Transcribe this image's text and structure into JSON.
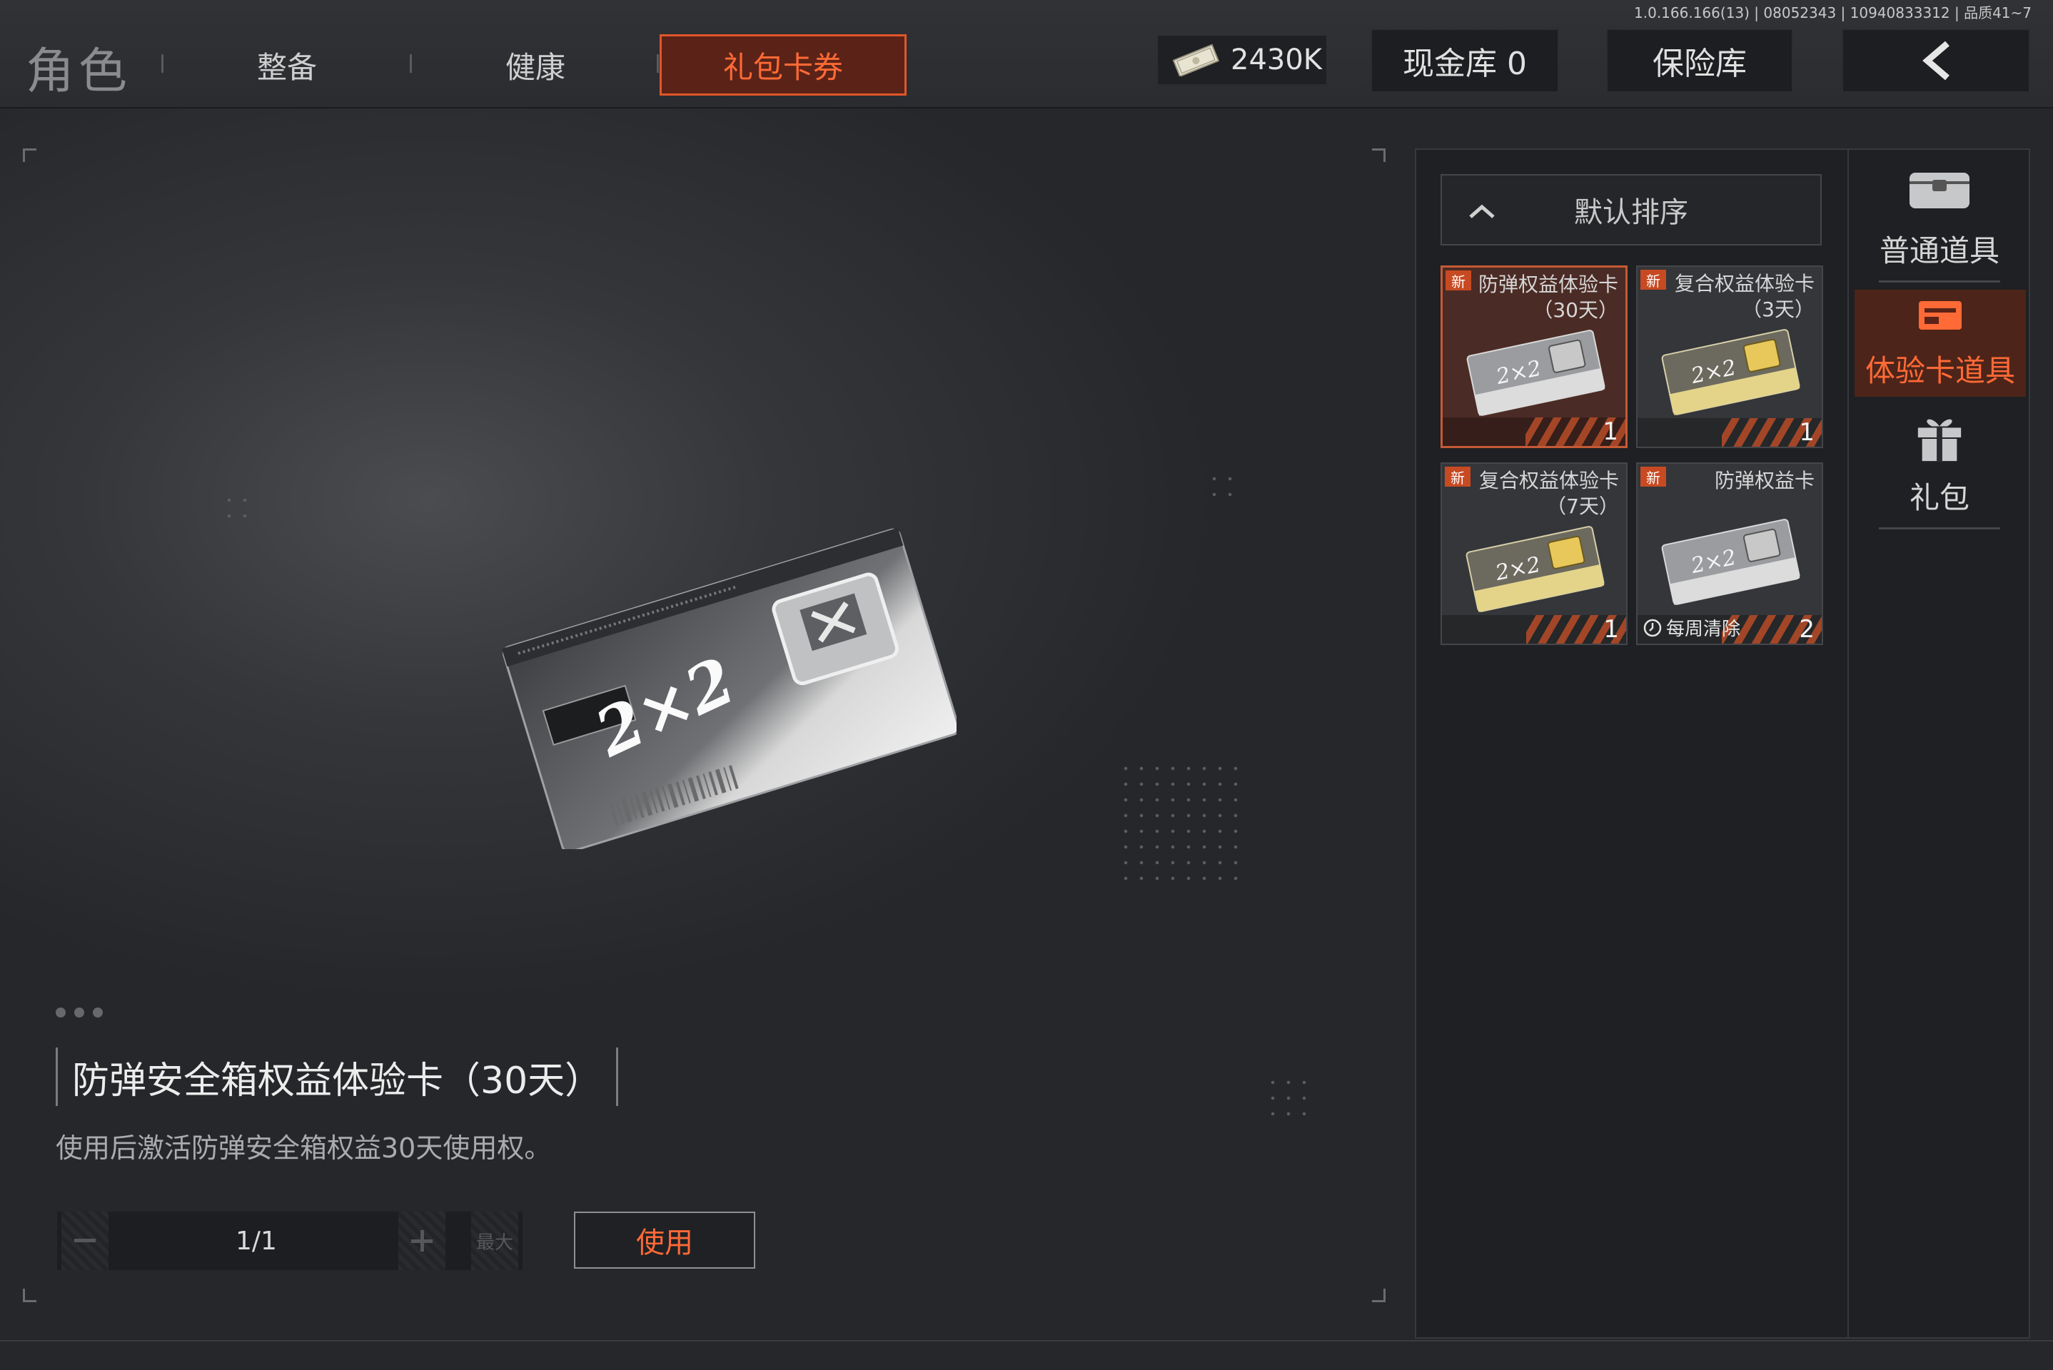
{
  "version": "1.0.166.166(13) | 08052343 | 10940833312 | 品质41~7",
  "nav": {
    "title": "角色",
    "tabs": [
      {
        "label": "整备"
      },
      {
        "label": "健康"
      },
      {
        "label": "礼包卡券",
        "active": true
      }
    ]
  },
  "header": {
    "cash_amount": "2430K",
    "cash_vault": "现金库 0",
    "safe_box": "保险库"
  },
  "detail": {
    "title": "防弹安全箱权益体验卡（30天）",
    "description": "使用后激活防弹安全箱权益30天使用权。",
    "quantity": "1/1",
    "max_label": "最大",
    "use_label": "使用"
  },
  "sort": {
    "label": "默认排序"
  },
  "items": [
    {
      "new_badge": "新",
      "name_line1": "防弹权益体验卡",
      "name_line2": "（30天）",
      "count": "1",
      "selected": true,
      "card_color": "silver"
    },
    {
      "new_badge": "新",
      "name_line1": "复合权益体验卡",
      "name_line2": "（3天）",
      "count": "1",
      "selected": false,
      "card_color": "gold"
    },
    {
      "new_badge": "新",
      "name_line1": "复合权益体验卡",
      "name_line2": "（7天）",
      "count": "1",
      "selected": false,
      "card_color": "gold"
    },
    {
      "new_badge": "新",
      "name_line1": "防弹权益卡",
      "name_line2": "",
      "count": "2",
      "selected": false,
      "card_color": "silver",
      "footer": "每周清除"
    }
  ],
  "categories": [
    {
      "label": "普通道具",
      "icon": "chest-icon"
    },
    {
      "label": "体验卡道具",
      "icon": "card-box-icon",
      "active": true
    },
    {
      "label": "礼包",
      "icon": "gift-icon"
    }
  ],
  "colors": {
    "accent": "#ff6a36",
    "accent_bg": "#5b2317",
    "panel": "#1f2023"
  }
}
